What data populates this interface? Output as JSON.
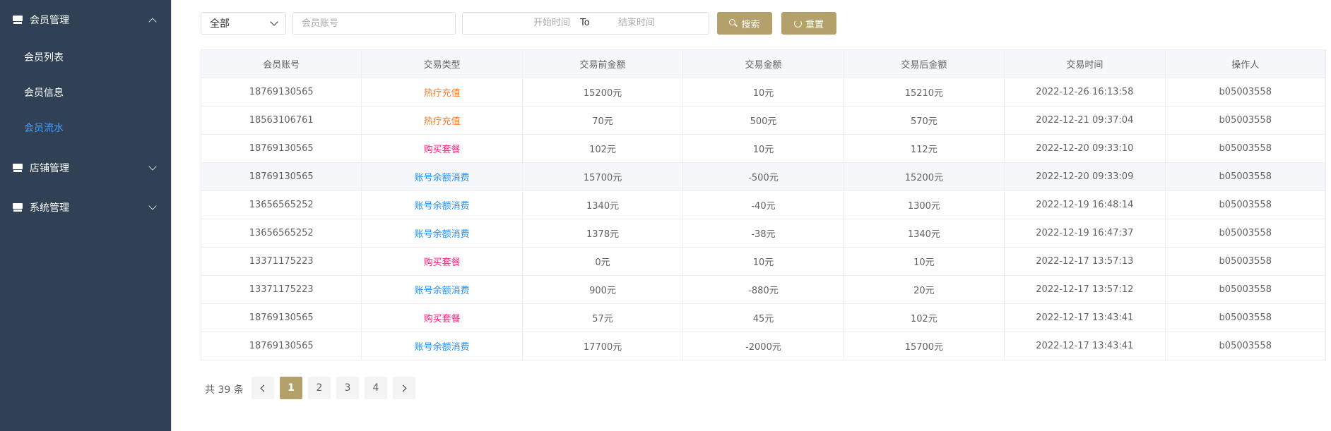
{
  "sidebar": {
    "menus": [
      {
        "label": "会员管理",
        "expanded": true,
        "icon": "store-icon",
        "items": [
          {
            "label": "会员列表",
            "active": false
          },
          {
            "label": "会员信息",
            "active": false
          },
          {
            "label": "会员流水",
            "active": true
          }
        ]
      },
      {
        "label": "店铺管理",
        "expanded": false,
        "icon": "store-icon"
      },
      {
        "label": "系统管理",
        "expanded": false,
        "icon": "store-icon"
      }
    ],
    "colors": {
      "background": "#304156",
      "active": "#409eff"
    }
  },
  "filters": {
    "type_select": {
      "value": "全部"
    },
    "account_input": {
      "placeholder": "会员账号",
      "value": ""
    },
    "date_range": {
      "start_placeholder": "开始时间",
      "separator": "To",
      "end_placeholder": "结束时间"
    },
    "search_label": "搜索",
    "reset_label": "重置",
    "accent": "#b3a06b"
  },
  "table": {
    "headers": [
      "会员账号",
      "交易类型",
      "交易前金额",
      "交易金额",
      "交易后金额",
      "交易时间",
      "操作人"
    ],
    "rows": [
      {
        "account": "18769130565",
        "type": "热疗充值",
        "type_kind": "recharge",
        "before": "15200元",
        "amount": "10元",
        "after": "15210元",
        "time": "2022-12-26 16:13:58",
        "operator": "b05003558"
      },
      {
        "account": "18563106761",
        "type": "热疗充值",
        "type_kind": "recharge",
        "before": "70元",
        "amount": "500元",
        "after": "570元",
        "time": "2022-12-21 09:37:04",
        "operator": "b05003558"
      },
      {
        "account": "18769130565",
        "type": "购买套餐",
        "type_kind": "package",
        "before": "102元",
        "amount": "10元",
        "after": "112元",
        "time": "2022-12-20 09:33:10",
        "operator": "b05003558"
      },
      {
        "account": "18769130565",
        "type": "账号余额消费",
        "type_kind": "consume",
        "before": "15700元",
        "amount": "-500元",
        "after": "15200元",
        "time": "2022-12-20 09:33:09",
        "operator": "b05003558"
      },
      {
        "account": "13656565252",
        "type": "账号余额消费",
        "type_kind": "consume",
        "before": "1340元",
        "amount": "-40元",
        "after": "1300元",
        "time": "2022-12-19 16:48:14",
        "operator": "b05003558"
      },
      {
        "account": "13656565252",
        "type": "账号余额消费",
        "type_kind": "consume",
        "before": "1378元",
        "amount": "-38元",
        "after": "1340元",
        "time": "2022-12-19 16:47:37",
        "operator": "b05003558"
      },
      {
        "account": "13371175223",
        "type": "购买套餐",
        "type_kind": "package",
        "before": "0元",
        "amount": "10元",
        "after": "10元",
        "time": "2022-12-17 13:57:13",
        "operator": "b05003558"
      },
      {
        "account": "13371175223",
        "type": "账号余额消费",
        "type_kind": "consume",
        "before": "900元",
        "amount": "-880元",
        "after": "20元",
        "time": "2022-12-17 13:57:12",
        "operator": "b05003558"
      },
      {
        "account": "18769130565",
        "type": "购买套餐",
        "type_kind": "package",
        "before": "57元",
        "amount": "45元",
        "after": "102元",
        "time": "2022-12-17 13:43:41",
        "operator": "b05003558"
      },
      {
        "account": "18769130565",
        "type": "账号余额消费",
        "type_kind": "consume",
        "before": "17700元",
        "amount": "-2000元",
        "after": "15700元",
        "time": "2022-12-17 13:43:41",
        "operator": "b05003558"
      }
    ],
    "hover_row_index": 3,
    "type_colors": {
      "recharge": "#ff7f2a",
      "package": "#ff1f7a",
      "consume": "#1e90ff"
    }
  },
  "pagination": {
    "total_text": "共 39 条",
    "pages": [
      "1",
      "2",
      "3",
      "4"
    ],
    "current_page": "1"
  }
}
